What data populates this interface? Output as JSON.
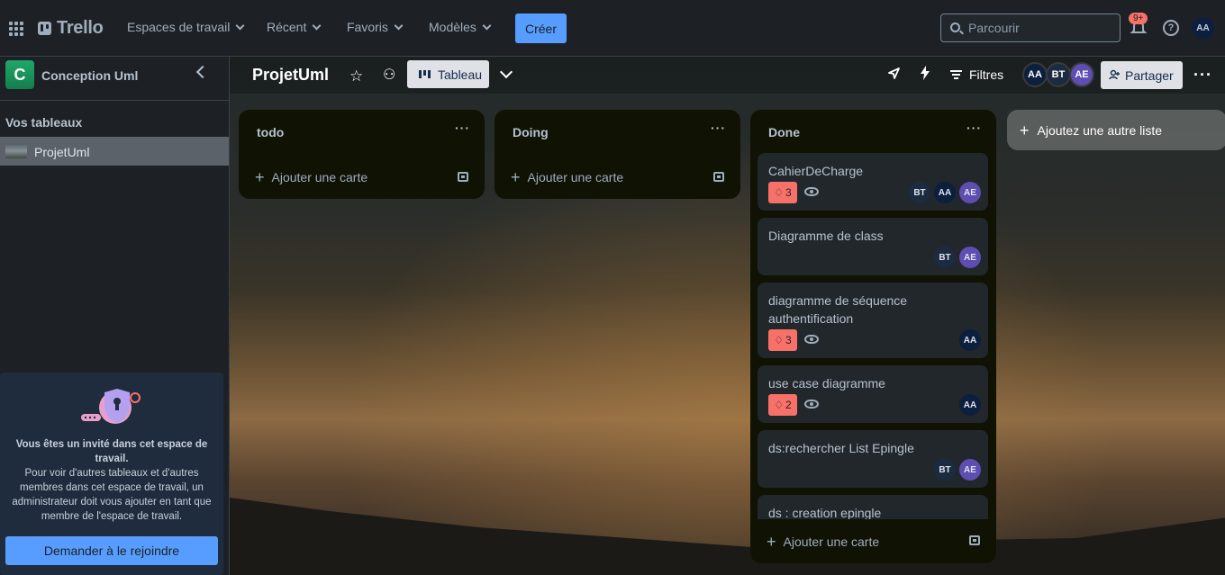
{
  "topnav": {
    "logo_text": "Trello",
    "menu": [
      {
        "label": "Espaces de travail"
      },
      {
        "label": "Récent"
      },
      {
        "label": "Favoris"
      },
      {
        "label": "Modèles"
      }
    ],
    "create_label": "Créer",
    "search_placeholder": "Parcourir",
    "notification_count": "9+",
    "user_initials": "AA"
  },
  "sidebar": {
    "workspace_initial": "C",
    "workspace_name": "Conception Uml",
    "section_title": "Vos tableaux",
    "boards": [
      {
        "name": "ProjetUml"
      }
    ],
    "guest": {
      "title": "Vous êtes un invité dans cet espace de travail.",
      "description": "Pour voir d'autres tableaux et d'autres membres dans cet espace de travail, un administrateur doit vous ajouter en tant que membre de l'espace de travail.",
      "join_label": "Demander à le rejoindre"
    }
  },
  "board": {
    "title": "ProjetUml",
    "view_label": "Tableau",
    "filters_label": "Filtres",
    "share_label": "Partager",
    "members": [
      {
        "initials": "AA",
        "color": "#0c1f3e"
      },
      {
        "initials": "BT",
        "color": "#1c2b41"
      },
      {
        "initials": "AE",
        "color": "#5e4db2"
      }
    ],
    "add_list_label": "Ajoutez une autre liste",
    "lists": [
      {
        "title": "todo",
        "add_card_label": "Ajouter une carte"
      },
      {
        "title": "Doing",
        "add_card_label": "Ajouter une carte"
      },
      {
        "title": "Done",
        "add_card_label": "Ajouter une carte",
        "cards": [
          {
            "title": "CahierDeCharge",
            "votes": "3",
            "watching": true,
            "members": [
              "BT",
              "AA",
              "AE"
            ]
          },
          {
            "title": "Diagramme de class",
            "members": [
              "BT",
              "AE"
            ]
          },
          {
            "title": "diagramme de séquence authentification",
            "votes": "3",
            "watching": true,
            "members": [
              "AA"
            ]
          },
          {
            "title": "use case diagramme",
            "votes": "2",
            "watching": true,
            "members": [
              "AA"
            ]
          },
          {
            "title": "ds:rechercher List Epingle",
            "members": [
              "BT",
              "AE"
            ]
          },
          {
            "title": "ds : creation epingle"
          }
        ]
      }
    ]
  },
  "colors": {
    "accent": "#579dff",
    "vote_badge": "#f87168",
    "member_AA": "#0c1f3e",
    "member_BT": "#1c2b41",
    "member_AE": "#5e4db2"
  }
}
